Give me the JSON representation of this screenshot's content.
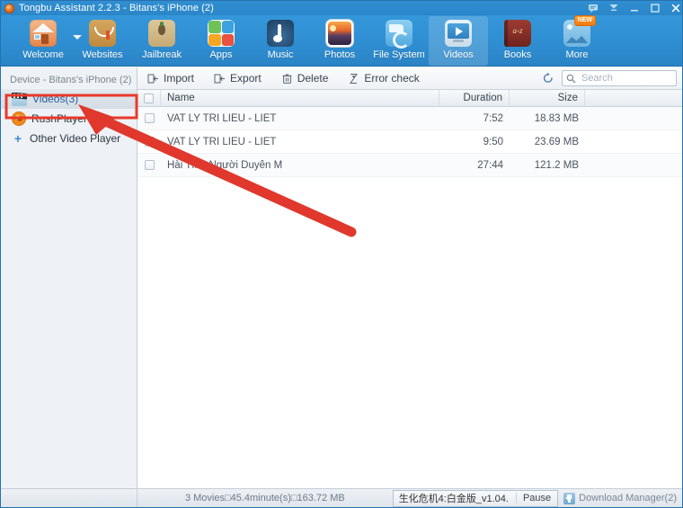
{
  "window": {
    "title": "Tongbu Assistant 2.2.3 - Bitans's iPhone (2)",
    "controls": [
      {
        "name": "feedback-icon",
        "label": "Feedback"
      },
      {
        "name": "download-icon",
        "label": "Downloads"
      },
      {
        "name": "minimize-button",
        "label": "Minimize"
      },
      {
        "name": "maximize-button",
        "label": "Maximize"
      },
      {
        "name": "close-button",
        "label": "Close"
      }
    ]
  },
  "navbar": {
    "items": [
      {
        "label": "Welcome",
        "icon": "house-icon",
        "active": false,
        "badge": ""
      },
      {
        "label": "Websites",
        "icon": "shopping-bag-icon",
        "active": false,
        "badge": ""
      },
      {
        "label": "Jailbreak",
        "icon": "pineapple-icon",
        "active": false,
        "badge": ""
      },
      {
        "label": "Apps",
        "icon": "app-grid-icon",
        "active": false,
        "badge": ""
      },
      {
        "label": "Music",
        "icon": "music-note-icon",
        "active": false,
        "badge": ""
      },
      {
        "label": "Photos",
        "icon": "photo-icon",
        "active": false,
        "badge": ""
      },
      {
        "label": "File System",
        "icon": "folder-sync-icon",
        "active": false,
        "badge": ""
      },
      {
        "label": "Videos",
        "icon": "video-play-icon",
        "active": true,
        "badge": ""
      },
      {
        "label": "Books",
        "icon": "book-icon",
        "active": false,
        "badge": ""
      },
      {
        "label": "More",
        "icon": "more-image-icon",
        "active": false,
        "badge": "NEW"
      }
    ]
  },
  "actionbar": {
    "import_label": "Import",
    "export_label": "Export",
    "delete_label": "Delete",
    "errorcheck_label": "Error check",
    "refresh_label": "Refresh",
    "search_placeholder": "Search",
    "search_value": ""
  },
  "sidebar": {
    "device_header": "Device - Bitans's iPhone (2)",
    "items": [
      {
        "label": "Videos(3)",
        "icon": "film-clapper-icon",
        "selected": true
      },
      {
        "label": "RushPlayer",
        "icon": "rushplayer-icon",
        "selected": false
      },
      {
        "label": "Other Video Player",
        "icon": "plus-icon",
        "selected": false
      }
    ]
  },
  "table": {
    "columns": [
      "Name",
      "Duration",
      "Size"
    ],
    "rows": [
      {
        "name": "VAT LY TRI LIEU - LIET",
        "duration": "7:52",
        "size": "18.83 MB",
        "checked": false
      },
      {
        "name": "VAT LY TRI LIEU - LIET",
        "duration": "9:50",
        "size": "23.69 MB",
        "checked": false
      },
      {
        "name": "Hài Tình Người Duyên M",
        "duration": "27:44",
        "size": "121.2 MB",
        "checked": false
      }
    ]
  },
  "statusbar": {
    "summary": "3 Movies□45.4minute(s)□163.72 MB",
    "download_name": "生化危机4:白金版_v1.04.",
    "pause_label": "Pause",
    "download_manager_label": "Download Manager(2)"
  },
  "annotation": {
    "highlight_color": "#e8392b",
    "arrow_color": "#e0382c"
  }
}
